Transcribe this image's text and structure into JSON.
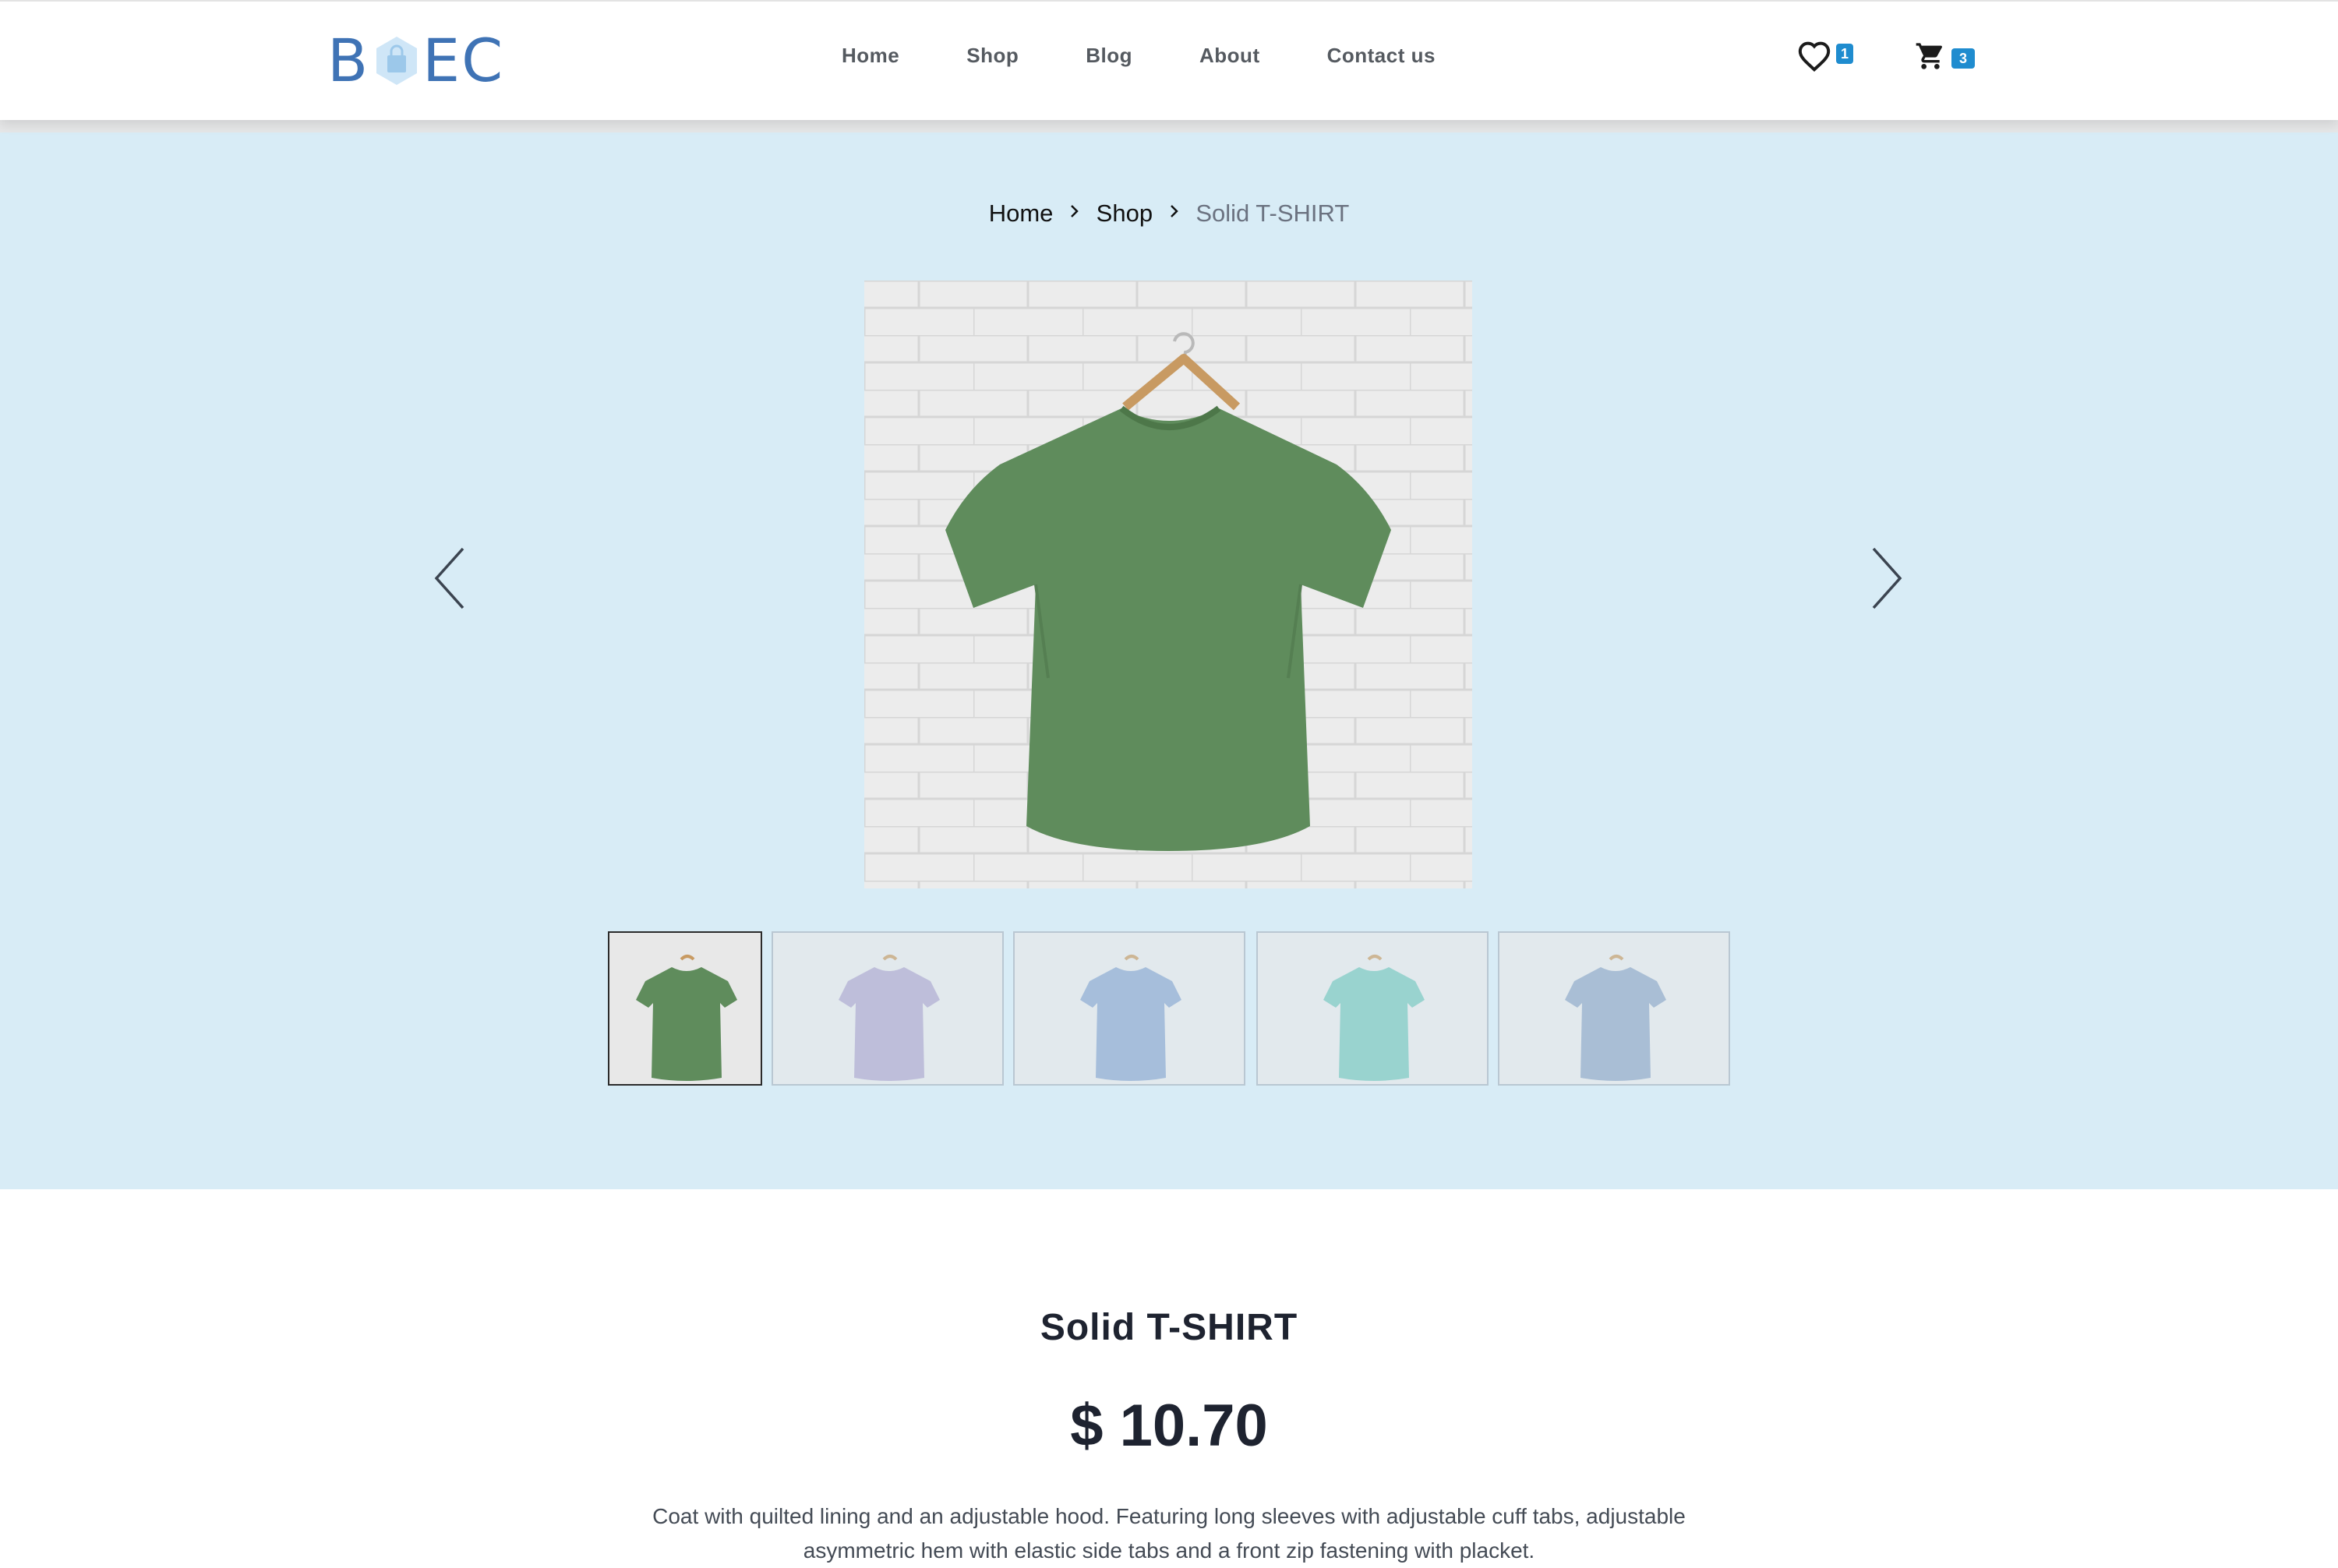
{
  "header": {
    "logo": {
      "text_left": "B",
      "text_right": "EC",
      "brand_color": "#3f73b5",
      "icon": "shopping-bag-icon"
    },
    "nav": [
      {
        "label": "Home"
      },
      {
        "label": "Shop"
      },
      {
        "label": "Blog"
      },
      {
        "label": "About"
      },
      {
        "label": "Contact us"
      }
    ],
    "wishlist": {
      "icon": "heart-icon",
      "count": "1"
    },
    "cart": {
      "icon": "cart-icon",
      "count": "3"
    },
    "badge_color": "#1f8ccf"
  },
  "hero": {
    "background": "#d8ecf6",
    "breadcrumb": [
      {
        "label": "Home"
      },
      {
        "label": "Shop"
      },
      {
        "label": "Solid T-SHIRT"
      }
    ],
    "gallery": {
      "prev_icon": "chevron-left-icon",
      "next_icon": "chevron-right-icon",
      "selected_index": 0,
      "thumbnails": [
        {
          "color": "#5f8c5c"
        },
        {
          "color": "#b1a6cb"
        },
        {
          "color": "#8ca7cc"
        },
        {
          "color": "#79c6bb"
        },
        {
          "color": "#91a7c3"
        }
      ]
    }
  },
  "product": {
    "title": "Solid T-SHIRT",
    "price": "$ 10.70",
    "description": "Coat with quilted lining and an adjustable hood. Featuring long sleeves with adjustable cuff tabs, adjustable asymmetric hem with elastic side tabs and a front zip fastening with placket."
  }
}
